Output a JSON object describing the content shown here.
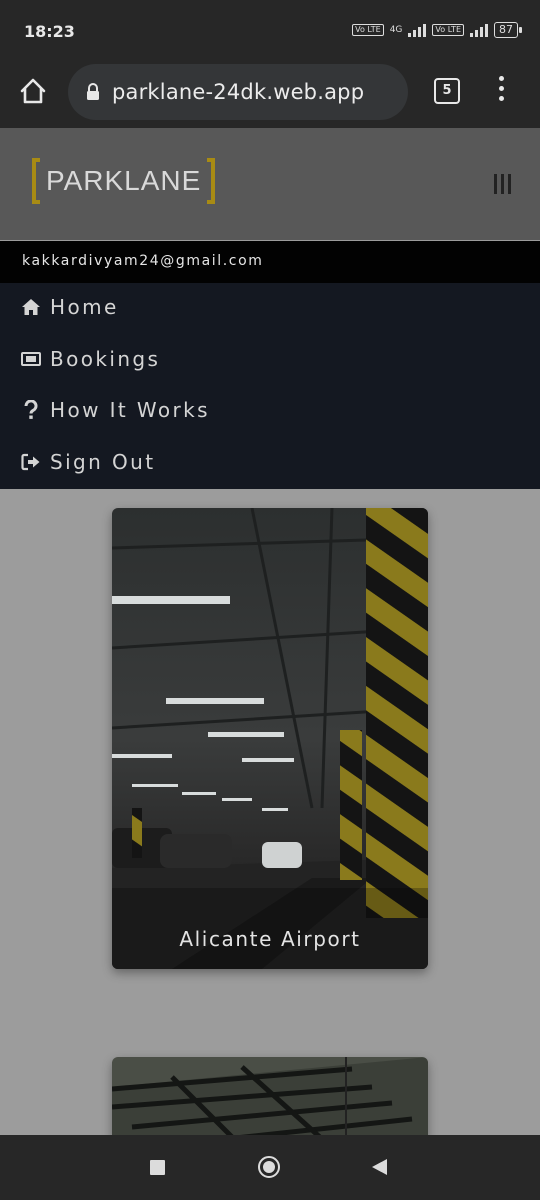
{
  "status_bar": {
    "time": "18:23",
    "network_label": "4G",
    "volte_label": "Vo LTE",
    "battery": "87"
  },
  "browser": {
    "url": "parklane-24dk.web.app",
    "tab_count": "5"
  },
  "site": {
    "logo_text": "PARKLANE",
    "user_email": "kakkardivyam24@gmail.com",
    "nav": [
      {
        "label": "Home",
        "icon": "home-icon"
      },
      {
        "label": "Bookings",
        "icon": "ticket-icon"
      },
      {
        "label": "How It Works",
        "icon": "question-icon"
      },
      {
        "label": "Sign Out",
        "icon": "sign-out-icon"
      }
    ]
  },
  "cards": [
    {
      "title": "Alicante Airport"
    },
    {
      "title": ""
    }
  ],
  "colors": {
    "header_bg": "#585858",
    "nav_bg": "#141821",
    "logo_accent": "#a88b14",
    "page_bg": "#9c9c9c"
  }
}
